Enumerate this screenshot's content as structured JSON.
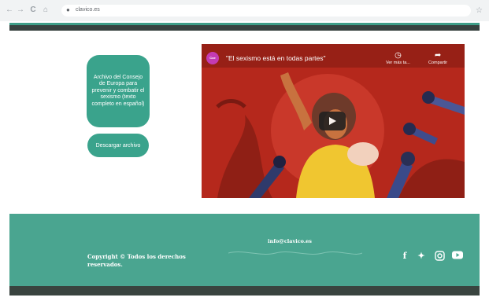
{
  "browser": {
    "url": "clavico.es",
    "back_icon": "←",
    "forward_icon": "→",
    "reload_icon": "C",
    "home_icon": "⌂",
    "star_icon": "☆"
  },
  "main": {
    "archive_text": "Archivo del Consejo de Europa para prevenir y combatir el sexismo (texto completo en español)",
    "download_label": "Descargar archivo"
  },
  "video": {
    "title": "\"El sexismo está en todas partes\"",
    "watch_later_label": "Ver más ta...",
    "share_label": "Compartir",
    "channel_badge": "Coe"
  },
  "footer": {
    "copyright": "Copyright © Todos los derechos reservados.",
    "email": "info@clavico.es"
  },
  "colors": {
    "accent": "#3aa38c",
    "footer": "#4aa590",
    "dark": "#37423f",
    "video_bg": "#b5281c"
  }
}
